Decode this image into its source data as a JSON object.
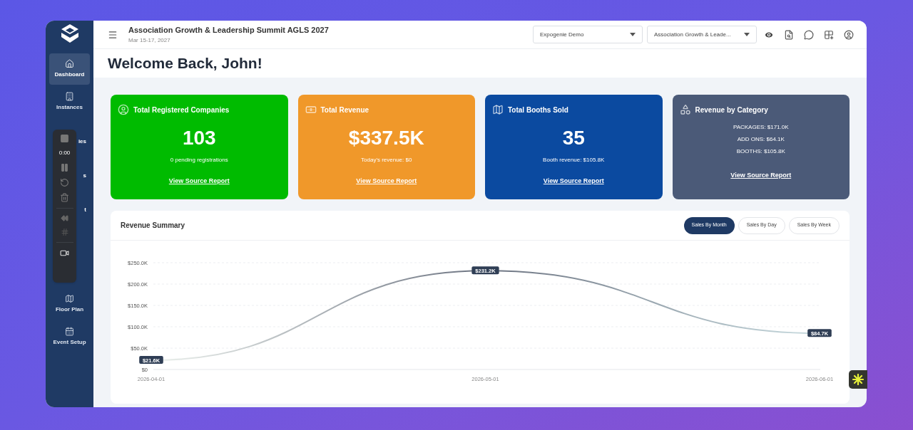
{
  "sidebar": {
    "items": [
      {
        "kind": "nav",
        "label": "Dashboard",
        "selected": true
      },
      {
        "kind": "nav",
        "label": "Instances",
        "selected": false
      },
      {
        "kind": "partial",
        "label": "ies"
      },
      {
        "kind": "partial",
        "label": "s"
      },
      {
        "kind": "partial",
        "label": "t"
      },
      {
        "kind": "nav",
        "label": "Floor Plan",
        "selected": false
      },
      {
        "kind": "nav",
        "label": "Event Setup",
        "selected": false
      }
    ]
  },
  "recorder": {
    "time": "0:00"
  },
  "header": {
    "title": "Association Growth & Leadership Summit AGLS 2027",
    "dates": "Mar 15-17, 2027",
    "selects": [
      {
        "value": "Expogenie Demo"
      },
      {
        "value": "Association Growth & Leade..."
      }
    ]
  },
  "welcome": "Welcome Back, John!",
  "cards": [
    {
      "kind": "metric",
      "color": "#00bb00",
      "title": "Total Registered Companies",
      "value": "103",
      "note": "0 pending registrations",
      "link": "View Source Report"
    },
    {
      "kind": "metric",
      "color": "#f0982a",
      "title": "Total Revenue",
      "value": "$337.5K",
      "note": "Today's revenue: $0",
      "link": "View Source Report"
    },
    {
      "kind": "metric",
      "color": "#0b4aa0",
      "title": "Total Booths Sold",
      "value": "35",
      "note": "Booth revenue: $105.8K",
      "link": "View Source Report"
    },
    {
      "kind": "breakdown",
      "color": "#4b5a78",
      "title": "Revenue by Category",
      "lines": [
        "PACKAGES: $171.0K",
        "ADD ONS: $64.1K",
        "BOOTHS: $105.8K"
      ],
      "link": "View Source Report"
    }
  ],
  "revenue_summary": {
    "title": "Revenue Summary",
    "tabs": [
      {
        "label": "Sales By Month",
        "selected": true
      },
      {
        "label": "Sales By Day",
        "selected": false
      },
      {
        "label": "Sales By Week",
        "selected": false
      }
    ],
    "chart_data": {
      "type": "line",
      "grid": true,
      "categories": [
        "2026-04-01",
        "2026-05-01",
        "2026-06-01"
      ],
      "values": [
        21600,
        231200,
        84700
      ],
      "value_labels": [
        "$21.6K",
        "$231.2K",
        "$84.7K"
      ],
      "ylim": [
        0,
        250000
      ],
      "yticks": [
        {
          "value": 0,
          "label": "$0"
        },
        {
          "value": 50000,
          "label": "$50.0K"
        },
        {
          "value": 100000,
          "label": "$100.0K"
        },
        {
          "value": 150000,
          "label": "$150.0K"
        },
        {
          "value": 200000,
          "label": "$200.0K"
        },
        {
          "value": 250000,
          "label": "$250.0K"
        }
      ]
    }
  }
}
